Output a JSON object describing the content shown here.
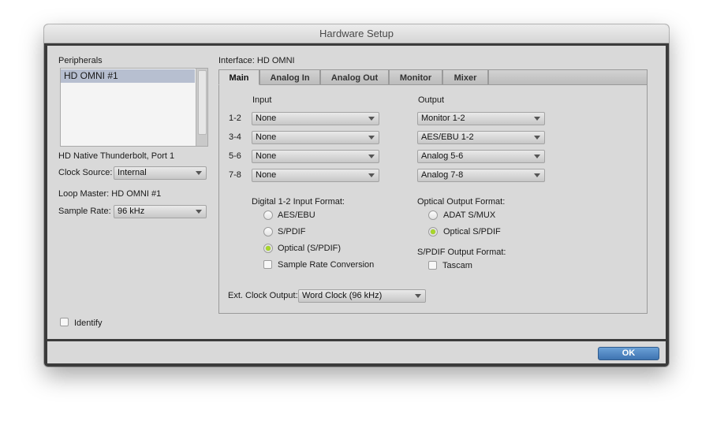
{
  "window": {
    "title": "Hardware Setup"
  },
  "peripherals": {
    "heading": "Peripherals",
    "items": [
      "HD OMNI #1"
    ],
    "connection": "HD Native Thunderbolt, Port 1",
    "clock_source_label": "Clock Source:",
    "clock_source_value": "Internal",
    "loop_master": "Loop Master: HD OMNI #1",
    "sample_rate_label": "Sample Rate:",
    "sample_rate_value": "96 kHz",
    "identify_label": "Identify"
  },
  "interface": {
    "label": "Interface: HD OMNI",
    "tabs": [
      "Main",
      "Analog In",
      "Analog Out",
      "Monitor",
      "Mixer"
    ],
    "active_tab": "Main"
  },
  "main": {
    "input_header": "Input",
    "output_header": "Output",
    "channels": [
      {
        "label": "1-2",
        "input": "None",
        "output": "Monitor 1-2"
      },
      {
        "label": "3-4",
        "input": "None",
        "output": "AES/EBU 1-2"
      },
      {
        "label": "5-6",
        "input": "None",
        "output": "Analog 5-6"
      },
      {
        "label": "7-8",
        "input": "None",
        "output": "Analog 7-8"
      }
    ],
    "digital_input_format": {
      "label": "Digital 1-2 Input Format:",
      "options": [
        "AES/EBU",
        "S/PDIF",
        "Optical (S/PDIF)"
      ],
      "selected": "Optical (S/PDIF)"
    },
    "sample_rate_conversion": {
      "label": "Sample Rate Conversion",
      "checked": false
    },
    "optical_output_format": {
      "label": "Optical Output Format:",
      "options": [
        "ADAT S/MUX",
        "Optical S/PDIF"
      ],
      "selected": "Optical S/PDIF"
    },
    "spdif_output_format": {
      "label": "S/PDIF Output Format:",
      "tascam_label": "Tascam",
      "tascam_checked": false
    },
    "ext_clock_output": {
      "label": "Ext. Clock Output:",
      "value": "Word Clock (96 kHz)"
    }
  },
  "footer": {
    "ok_label": "OK"
  },
  "colors": {
    "accent": "#3f74b1",
    "radio_selected": "#a8d62a",
    "panel": "#d9d9d9",
    "list_selection": "#b7bfd0"
  }
}
